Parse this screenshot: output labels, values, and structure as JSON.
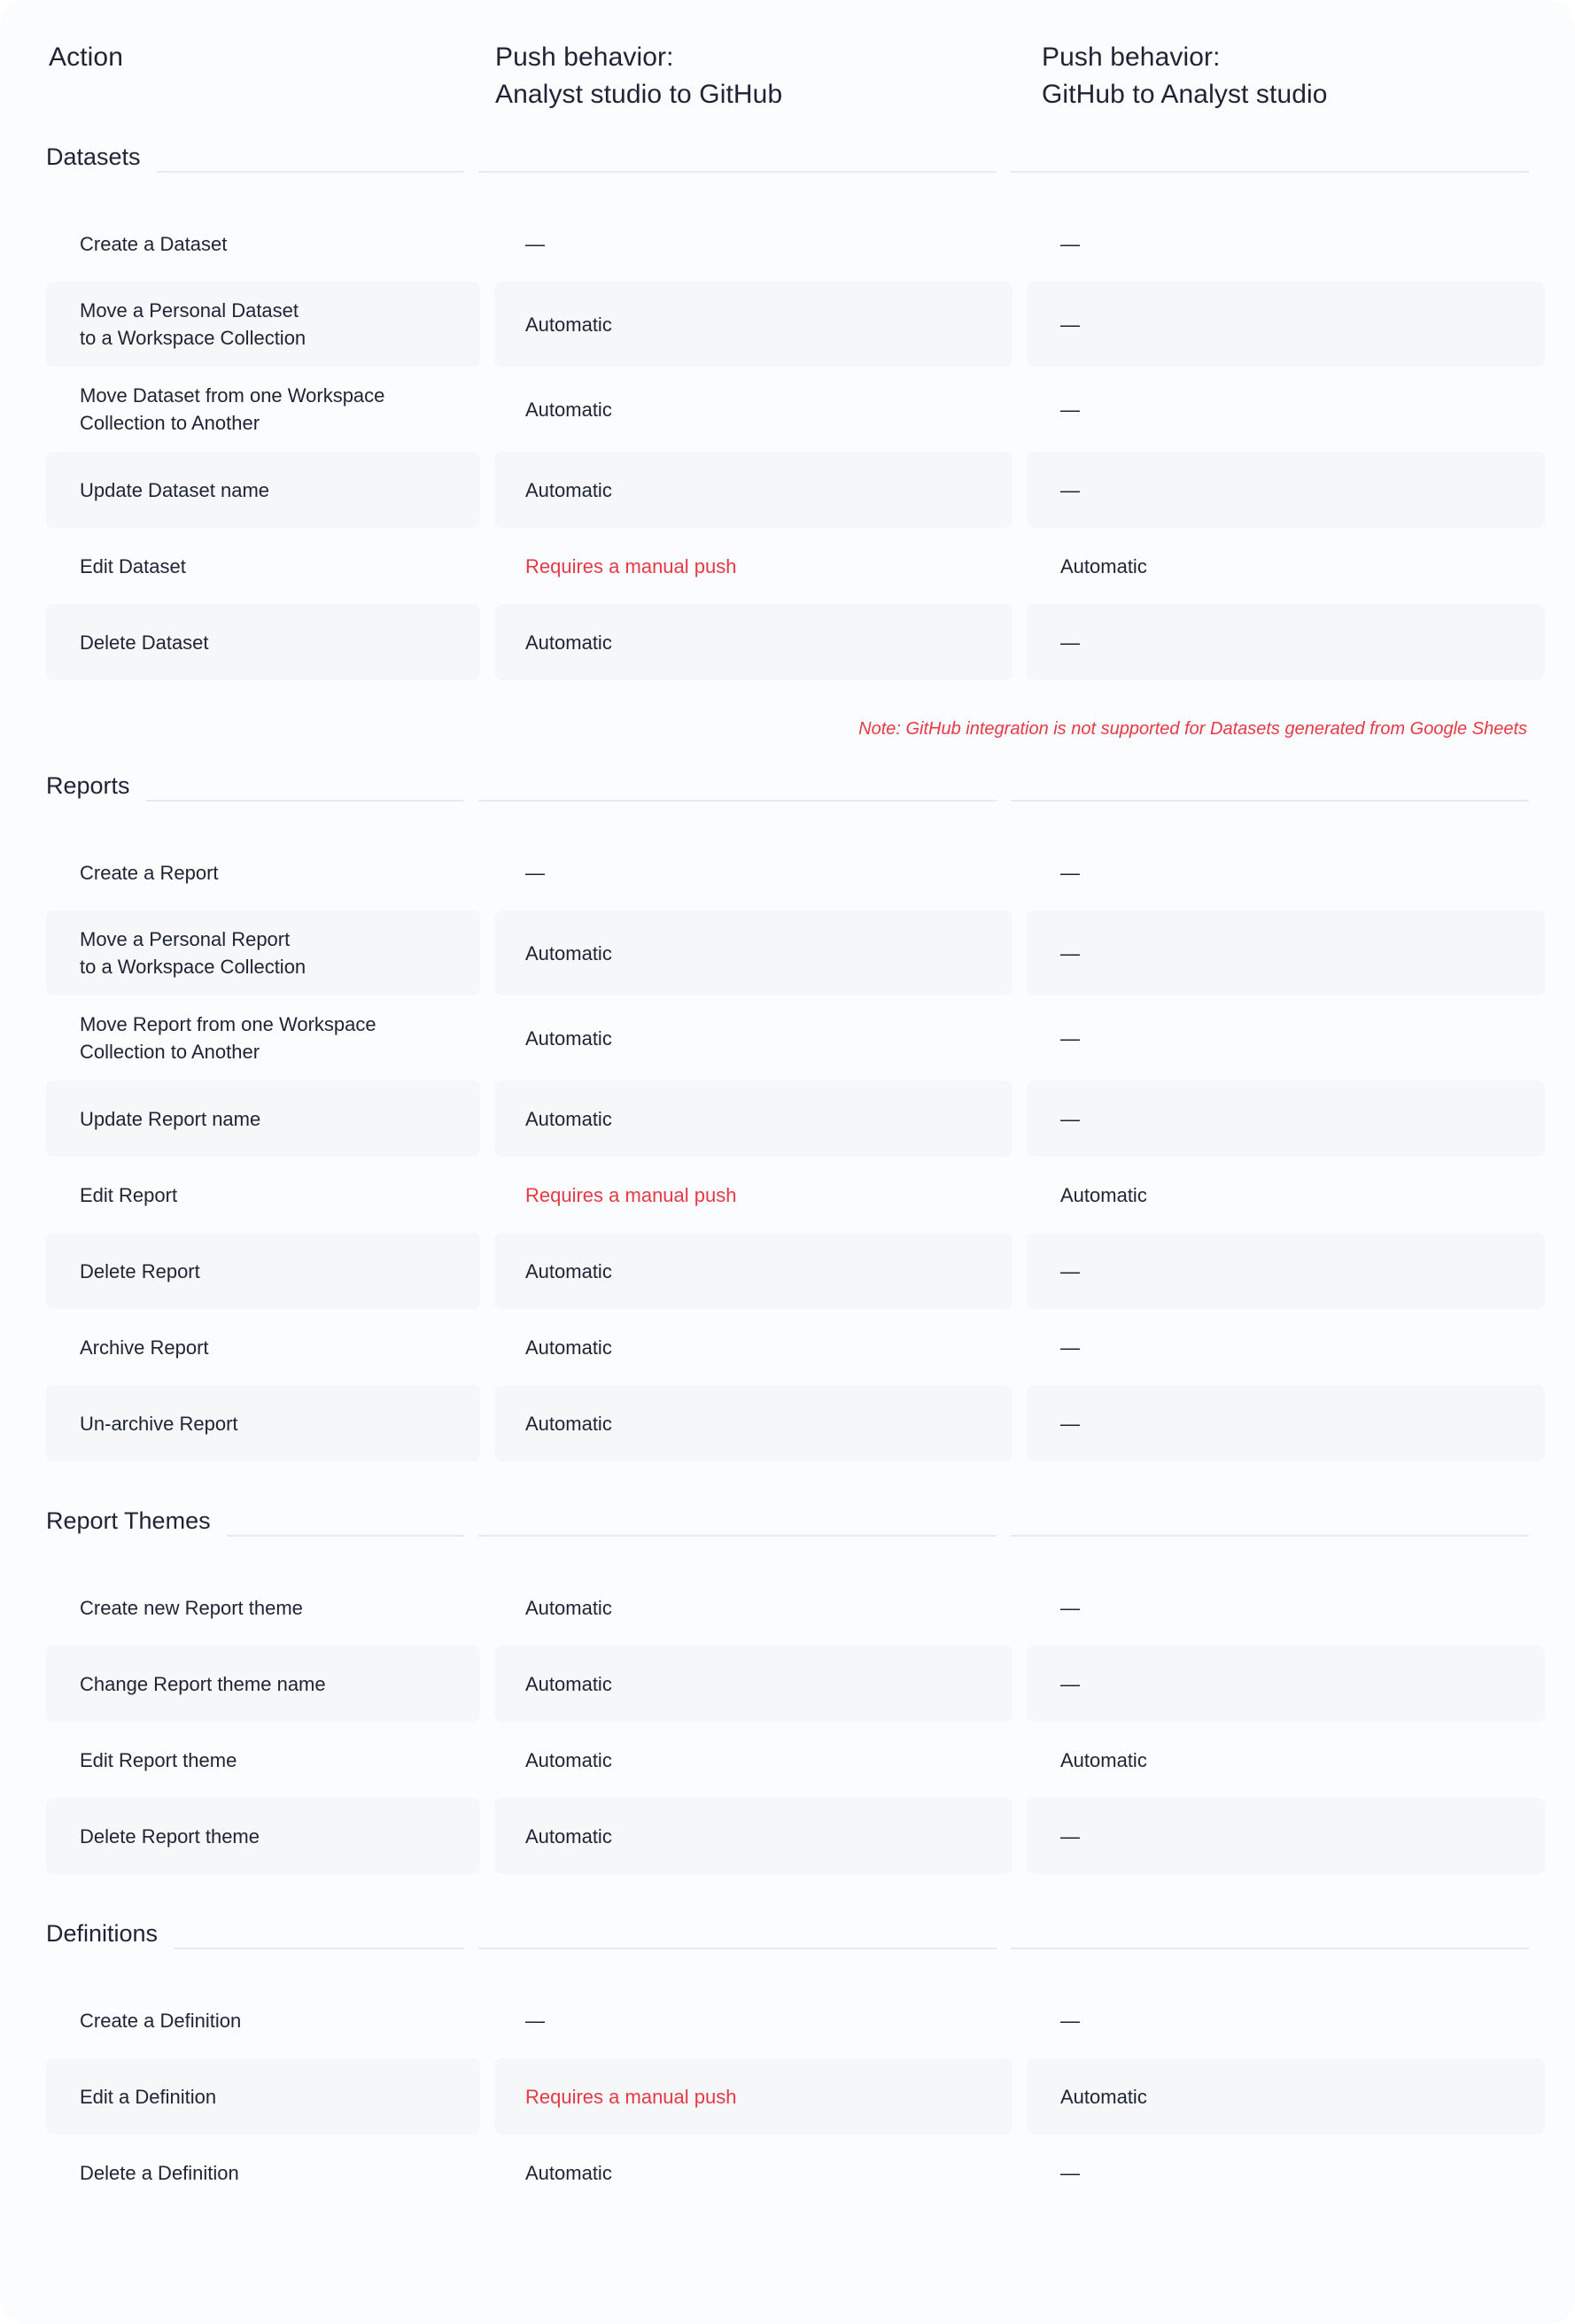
{
  "colors": {
    "text": "#1d2433",
    "accent_red": "#e63946",
    "row_shade": "#f5f7f9",
    "rule": "#e7ebf0",
    "card_bg": "#fbfcfd"
  },
  "header": {
    "col_action": "Action",
    "col_push_to_github": "Push behavior:\nAnalyst studio to GitHub",
    "col_push_from_github": "Push behavior:\nGitHub to Analyst studio"
  },
  "values": {
    "automatic": "Automatic",
    "manual": "Requires a manual push",
    "dash": "—"
  },
  "sections": [
    {
      "title": "Datasets",
      "rows": [
        {
          "action": "Create a Dataset",
          "to_github": "—",
          "from_github": "—",
          "to_github_style": "plain",
          "shaded": false,
          "tall": false
        },
        {
          "action": "Move a Personal Dataset\nto a Workspace Collection",
          "to_github": "Automatic",
          "from_github": "—",
          "to_github_style": "plain",
          "shaded": true,
          "tall": true
        },
        {
          "action": "Move Dataset from one Workspace\nCollection to Another",
          "to_github": "Automatic",
          "from_github": "—",
          "to_github_style": "plain",
          "shaded": false,
          "tall": true
        },
        {
          "action": "Update Dataset name",
          "to_github": "Automatic",
          "from_github": "—",
          "to_github_style": "plain",
          "shaded": true,
          "tall": false
        },
        {
          "action": "Edit Dataset",
          "to_github": "Requires a manual push",
          "from_github": "Automatic",
          "to_github_style": "manual",
          "shaded": false,
          "tall": false
        },
        {
          "action": "Delete Dataset",
          "to_github": "Automatic",
          "from_github": "—",
          "to_github_style": "plain",
          "shaded": true,
          "tall": false
        }
      ],
      "note": "Note: GitHub integration is not supported for Datasets generated from Google Sheets"
    },
    {
      "title": "Reports",
      "rows": [
        {
          "action": "Create a Report",
          "to_github": "—",
          "from_github": "—",
          "to_github_style": "plain",
          "shaded": false,
          "tall": false
        },
        {
          "action": "Move a Personal Report\nto a Workspace Collection",
          "to_github": "Automatic",
          "from_github": "—",
          "to_github_style": "plain",
          "shaded": true,
          "tall": true
        },
        {
          "action": "Move Report from one Workspace\nCollection to Another",
          "to_github": "Automatic",
          "from_github": "—",
          "to_github_style": "plain",
          "shaded": false,
          "tall": true
        },
        {
          "action": "Update Report name",
          "to_github": "Automatic",
          "from_github": "—",
          "to_github_style": "plain",
          "shaded": true,
          "tall": false
        },
        {
          "action": "Edit Report",
          "to_github": "Requires a manual push",
          "from_github": "Automatic",
          "to_github_style": "manual",
          "shaded": false,
          "tall": false
        },
        {
          "action": "Delete Report",
          "to_github": "Automatic",
          "from_github": "—",
          "to_github_style": "plain",
          "shaded": true,
          "tall": false
        },
        {
          "action": "Archive Report",
          "to_github": "Automatic",
          "from_github": "—",
          "to_github_style": "plain",
          "shaded": false,
          "tall": false
        },
        {
          "action": "Un-archive Report",
          "to_github": "Automatic",
          "from_github": "—",
          "to_github_style": "plain",
          "shaded": true,
          "tall": false
        }
      ],
      "note": null
    },
    {
      "title": "Report Themes",
      "rows": [
        {
          "action": "Create new Report theme",
          "to_github": "Automatic",
          "from_github": "—",
          "to_github_style": "plain",
          "shaded": false,
          "tall": false
        },
        {
          "action": "Change Report theme name",
          "to_github": "Automatic",
          "from_github": "—",
          "to_github_style": "plain",
          "shaded": true,
          "tall": false
        },
        {
          "action": "Edit Report theme",
          "to_github": "Automatic",
          "from_github": "Automatic",
          "to_github_style": "plain",
          "shaded": false,
          "tall": false
        },
        {
          "action": "Delete Report theme",
          "to_github": "Automatic",
          "from_github": "—",
          "to_github_style": "plain",
          "shaded": true,
          "tall": false
        }
      ],
      "note": null
    },
    {
      "title": "Definitions",
      "rows": [
        {
          "action": "Create a Definition",
          "to_github": "—",
          "from_github": "—",
          "to_github_style": "plain",
          "shaded": false,
          "tall": false
        },
        {
          "action": "Edit a Definition",
          "to_github": "Requires a manual push",
          "from_github": "Automatic",
          "to_github_style": "manual",
          "shaded": true,
          "tall": false
        },
        {
          "action": "Delete a Definition",
          "to_github": "Automatic",
          "from_github": "—",
          "to_github_style": "plain",
          "shaded": false,
          "tall": false
        }
      ],
      "note": null
    }
  ]
}
